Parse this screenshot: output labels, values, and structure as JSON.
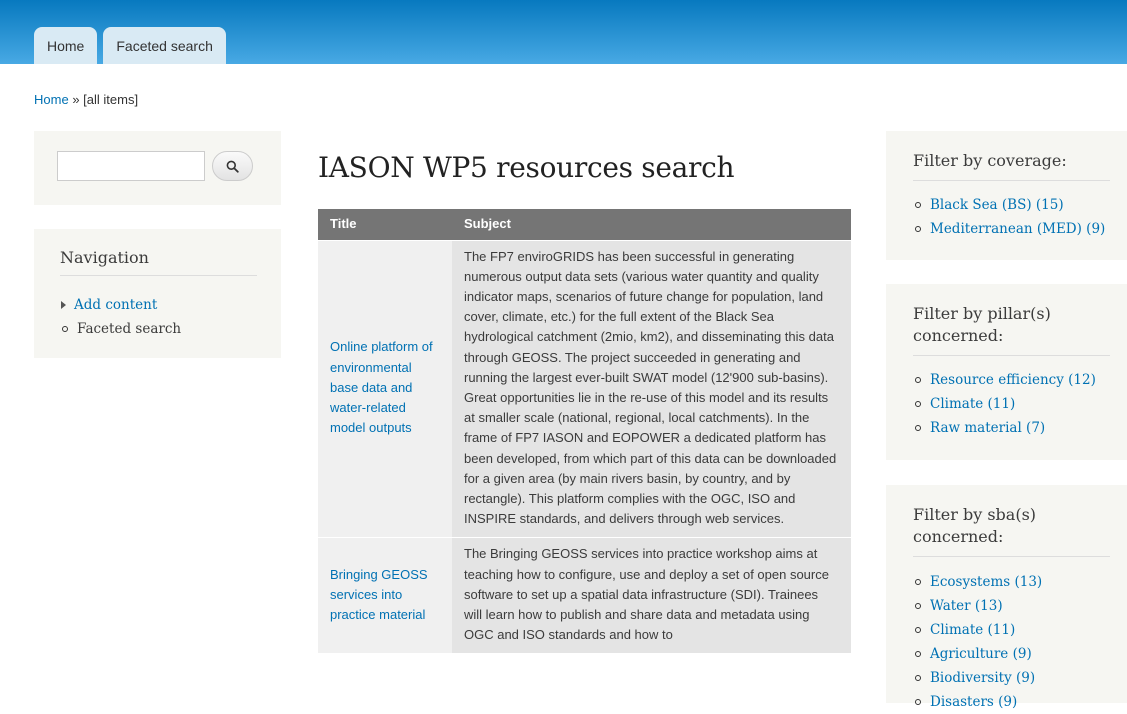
{
  "tabs": [
    {
      "label": "Home"
    },
    {
      "label": "Faceted search"
    }
  ],
  "breadcrumb": {
    "home": "Home",
    "separator": "»",
    "current": "[all items]"
  },
  "search": {
    "placeholder": "",
    "value": "",
    "button_icon": "search-icon"
  },
  "navigation": {
    "title": "Navigation",
    "items": [
      {
        "label": "Add content"
      },
      {
        "label": "Faceted search"
      }
    ]
  },
  "page_title": "IASON WP5 resources search",
  "results": {
    "headers": [
      "Title",
      "Subject"
    ],
    "rows": [
      {
        "title": "Online platform of environmental base data and water-related model outputs",
        "subject": "The FP7 enviroGRIDS has been successful in generating numerous output data sets (various water quantity and quality indicator maps, scenarios of future change for population, land cover, climate, etc.) for the full extent of the Black Sea hydrological catchment (2mio, km2), and disseminating this data through GEOSS. The project succeeded in generating and running the largest ever-built SWAT model (12'900 sub-basins). Great opportunities lie in the re-use of this model and its results at smaller scale (national, regional, local catchments). In the frame of FP7 IASON and EOPOWER a dedicated platform has been developed, from which part of this data can be downloaded for a given area (by main rivers basin, by country, and by rectangle). This platform complies with the OGC, ISO and INSPIRE standards, and delivers through web services."
      },
      {
        "title": "Bringing GEOSS services into practice material",
        "subject": "The Bringing GEOSS services into practice workshop aims at teaching how to configure, use and deploy a set of open source software to set up a spatial data infrastructure (SDI). Trainees will learn how to publish and share data and metadata using OGC and ISO standards and how to"
      }
    ]
  },
  "filters": {
    "coverage": {
      "title": "Filter by coverage:",
      "items": [
        {
          "label": "Black Sea (BS) (15)"
        },
        {
          "label": "Mediterranean (MED) (9)"
        }
      ]
    },
    "pillar": {
      "title": "Filter by pillar(s) concerned:",
      "items": [
        {
          "label": "Resource efficiency (12)"
        },
        {
          "label": "Climate (11)"
        },
        {
          "label": "Raw material (7)"
        }
      ]
    },
    "sba": {
      "title": "Filter by sba(s) concerned:",
      "items": [
        {
          "label": "Ecosystems (13)"
        },
        {
          "label": "Water (13)"
        },
        {
          "label": "Climate (11)"
        },
        {
          "label": "Agriculture (9)"
        },
        {
          "label": "Biodiversity (9)"
        },
        {
          "label": "Disasters (9)"
        }
      ]
    }
  },
  "colors": {
    "header_top": "#0779bf",
    "header_bottom": "#48a9e4",
    "link": "#0071b3",
    "table_header": "#757575"
  }
}
